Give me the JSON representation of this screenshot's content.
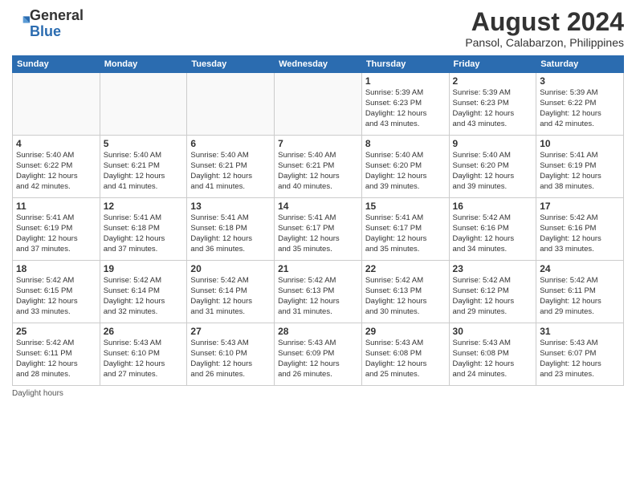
{
  "logo": {
    "general": "General",
    "blue": "Blue"
  },
  "title": "August 2024",
  "subtitle": "Pansol, Calabarzon, Philippines",
  "days_header": [
    "Sunday",
    "Monday",
    "Tuesday",
    "Wednesday",
    "Thursday",
    "Friday",
    "Saturday"
  ],
  "weeks": [
    [
      {
        "day": "",
        "info": ""
      },
      {
        "day": "",
        "info": ""
      },
      {
        "day": "",
        "info": ""
      },
      {
        "day": "",
        "info": ""
      },
      {
        "day": "1",
        "info": "Sunrise: 5:39 AM\nSunset: 6:23 PM\nDaylight: 12 hours\nand 43 minutes."
      },
      {
        "day": "2",
        "info": "Sunrise: 5:39 AM\nSunset: 6:23 PM\nDaylight: 12 hours\nand 43 minutes."
      },
      {
        "day": "3",
        "info": "Sunrise: 5:39 AM\nSunset: 6:22 PM\nDaylight: 12 hours\nand 42 minutes."
      }
    ],
    [
      {
        "day": "4",
        "info": "Sunrise: 5:40 AM\nSunset: 6:22 PM\nDaylight: 12 hours\nand 42 minutes."
      },
      {
        "day": "5",
        "info": "Sunrise: 5:40 AM\nSunset: 6:21 PM\nDaylight: 12 hours\nand 41 minutes."
      },
      {
        "day": "6",
        "info": "Sunrise: 5:40 AM\nSunset: 6:21 PM\nDaylight: 12 hours\nand 41 minutes."
      },
      {
        "day": "7",
        "info": "Sunrise: 5:40 AM\nSunset: 6:21 PM\nDaylight: 12 hours\nand 40 minutes."
      },
      {
        "day": "8",
        "info": "Sunrise: 5:40 AM\nSunset: 6:20 PM\nDaylight: 12 hours\nand 39 minutes."
      },
      {
        "day": "9",
        "info": "Sunrise: 5:40 AM\nSunset: 6:20 PM\nDaylight: 12 hours\nand 39 minutes."
      },
      {
        "day": "10",
        "info": "Sunrise: 5:41 AM\nSunset: 6:19 PM\nDaylight: 12 hours\nand 38 minutes."
      }
    ],
    [
      {
        "day": "11",
        "info": "Sunrise: 5:41 AM\nSunset: 6:19 PM\nDaylight: 12 hours\nand 37 minutes."
      },
      {
        "day": "12",
        "info": "Sunrise: 5:41 AM\nSunset: 6:18 PM\nDaylight: 12 hours\nand 37 minutes."
      },
      {
        "day": "13",
        "info": "Sunrise: 5:41 AM\nSunset: 6:18 PM\nDaylight: 12 hours\nand 36 minutes."
      },
      {
        "day": "14",
        "info": "Sunrise: 5:41 AM\nSunset: 6:17 PM\nDaylight: 12 hours\nand 35 minutes."
      },
      {
        "day": "15",
        "info": "Sunrise: 5:41 AM\nSunset: 6:17 PM\nDaylight: 12 hours\nand 35 minutes."
      },
      {
        "day": "16",
        "info": "Sunrise: 5:42 AM\nSunset: 6:16 PM\nDaylight: 12 hours\nand 34 minutes."
      },
      {
        "day": "17",
        "info": "Sunrise: 5:42 AM\nSunset: 6:16 PM\nDaylight: 12 hours\nand 33 minutes."
      }
    ],
    [
      {
        "day": "18",
        "info": "Sunrise: 5:42 AM\nSunset: 6:15 PM\nDaylight: 12 hours\nand 33 minutes."
      },
      {
        "day": "19",
        "info": "Sunrise: 5:42 AM\nSunset: 6:14 PM\nDaylight: 12 hours\nand 32 minutes."
      },
      {
        "day": "20",
        "info": "Sunrise: 5:42 AM\nSunset: 6:14 PM\nDaylight: 12 hours\nand 31 minutes."
      },
      {
        "day": "21",
        "info": "Sunrise: 5:42 AM\nSunset: 6:13 PM\nDaylight: 12 hours\nand 31 minutes."
      },
      {
        "day": "22",
        "info": "Sunrise: 5:42 AM\nSunset: 6:13 PM\nDaylight: 12 hours\nand 30 minutes."
      },
      {
        "day": "23",
        "info": "Sunrise: 5:42 AM\nSunset: 6:12 PM\nDaylight: 12 hours\nand 29 minutes."
      },
      {
        "day": "24",
        "info": "Sunrise: 5:42 AM\nSunset: 6:11 PM\nDaylight: 12 hours\nand 29 minutes."
      }
    ],
    [
      {
        "day": "25",
        "info": "Sunrise: 5:42 AM\nSunset: 6:11 PM\nDaylight: 12 hours\nand 28 minutes."
      },
      {
        "day": "26",
        "info": "Sunrise: 5:43 AM\nSunset: 6:10 PM\nDaylight: 12 hours\nand 27 minutes."
      },
      {
        "day": "27",
        "info": "Sunrise: 5:43 AM\nSunset: 6:10 PM\nDaylight: 12 hours\nand 26 minutes."
      },
      {
        "day": "28",
        "info": "Sunrise: 5:43 AM\nSunset: 6:09 PM\nDaylight: 12 hours\nand 26 minutes."
      },
      {
        "day": "29",
        "info": "Sunrise: 5:43 AM\nSunset: 6:08 PM\nDaylight: 12 hours\nand 25 minutes."
      },
      {
        "day": "30",
        "info": "Sunrise: 5:43 AM\nSunset: 6:08 PM\nDaylight: 12 hours\nand 24 minutes."
      },
      {
        "day": "31",
        "info": "Sunrise: 5:43 AM\nSunset: 6:07 PM\nDaylight: 12 hours\nand 23 minutes."
      }
    ]
  ],
  "footer": "Daylight hours"
}
